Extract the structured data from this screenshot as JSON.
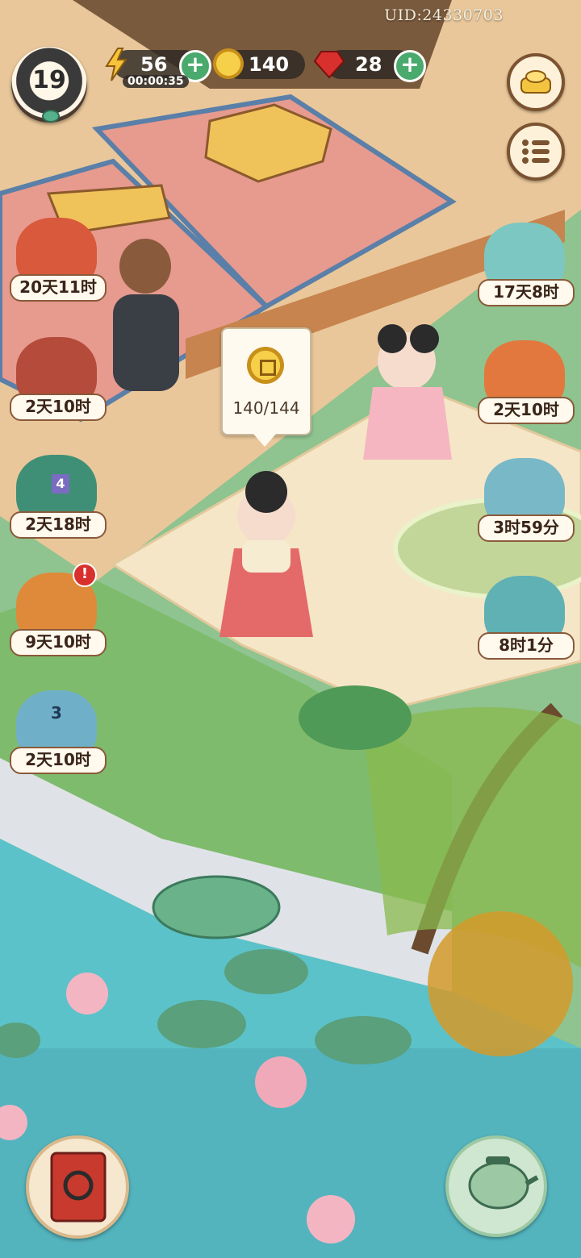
{
  "hud": {
    "uid": "UID:24330703",
    "level": "19",
    "energy": "56",
    "energy_timer": "00:00:35",
    "coins": "140",
    "gems": "28"
  },
  "speech_bubble": {
    "coin_progress": "140/144"
  },
  "events_left": [
    {
      "label": "20天11时",
      "icon": "scroll-book-icon"
    },
    {
      "label": "2天10时",
      "icon": "tea-set-icon"
    },
    {
      "label": "2天18时",
      "icon": "shop-gate-icon",
      "badge": "4"
    },
    {
      "label": "9天10时",
      "icon": "golden-bowl-icon",
      "alert": "!"
    },
    {
      "label": "2天10时",
      "icon": "lotus-icon",
      "badge": "3"
    }
  ],
  "events_right": [
    {
      "label": "17天8时",
      "icon": "jade-cat-icon"
    },
    {
      "label": "2天10时",
      "icon": "fortune-cat-icon"
    },
    {
      "label": "3时59分",
      "icon": "treasure-icon"
    },
    {
      "label": "8时1分",
      "icon": "gift-box-icon"
    }
  ],
  "colors": {
    "accent_green": "#4aa96c",
    "label_border": "#8a5a3a",
    "alert_red": "#d8302c"
  }
}
